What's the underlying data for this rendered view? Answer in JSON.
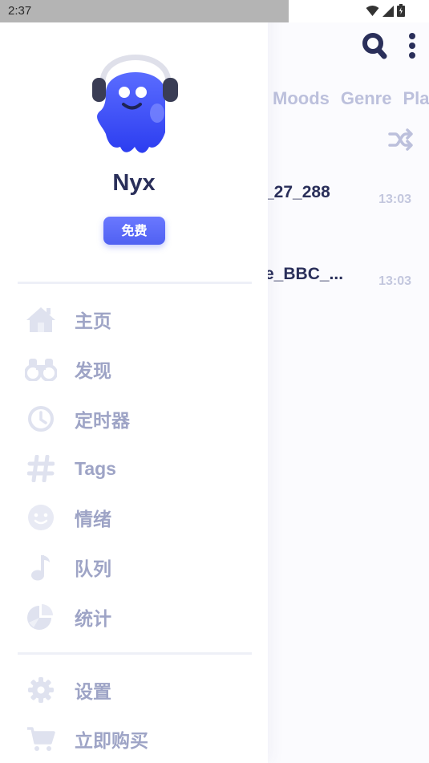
{
  "status_bar": {
    "time": "2:37"
  },
  "main": {
    "tabs": [
      "Moods",
      "Genre",
      "Pla"
    ],
    "tracks": [
      {
        "title": "_27_288",
        "time": "13:03"
      },
      {
        "title": "e_BBC_...",
        "time": "13:03"
      }
    ]
  },
  "drawer": {
    "user": {
      "name": "Nyx",
      "plan": "免费"
    },
    "menu": [
      {
        "label": "主页",
        "icon": "home-icon"
      },
      {
        "label": "发现",
        "icon": "binoculars-icon"
      },
      {
        "label": "定时器",
        "icon": "clock-icon"
      },
      {
        "label": "Tags",
        "icon": "hashtag-icon"
      },
      {
        "label": "情绪",
        "icon": "smiley-icon"
      },
      {
        "label": "队列",
        "icon": "music-note-icon"
      },
      {
        "label": "统计",
        "icon": "pie-chart-icon"
      }
    ],
    "footer_menu": [
      {
        "label": "设置",
        "icon": "gear-icon"
      },
      {
        "label": "立即购买",
        "icon": "cart-icon"
      }
    ]
  },
  "colors": {
    "accent": "#5061f2",
    "menu_text": "#9ea4c6",
    "title_text": "#2a2f5a",
    "icon_muted": "#dfe2ef"
  }
}
